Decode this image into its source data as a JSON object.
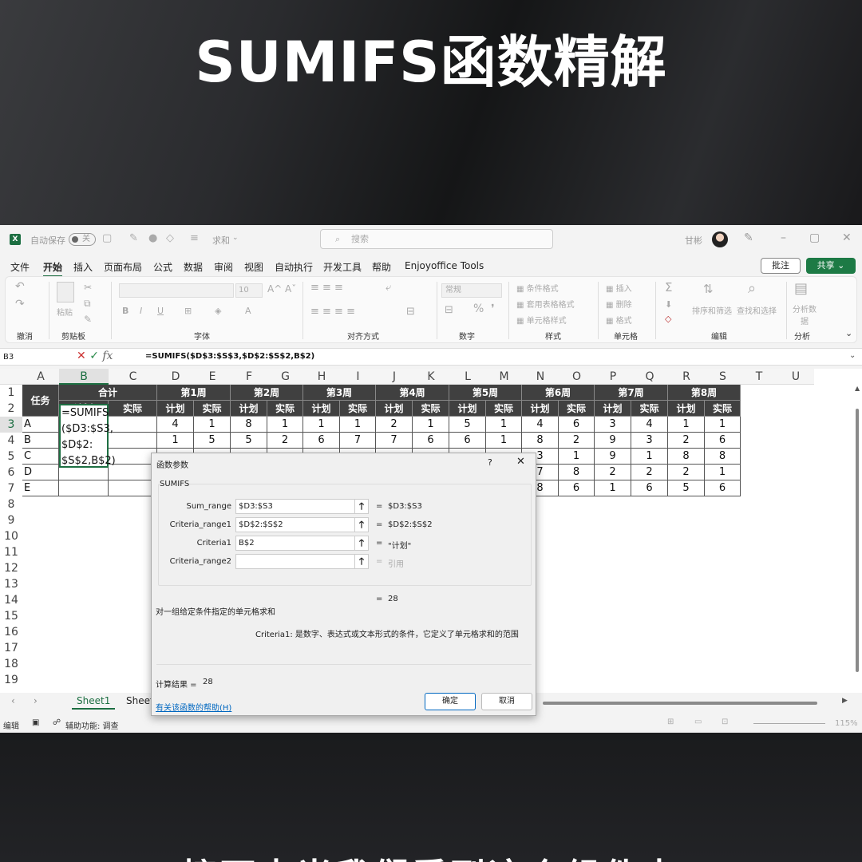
{
  "headline": "SUMIFS函数精解",
  "subtitle": "接下来当我们看到这个组件中",
  "titlebar": {
    "autosave_label": "自动保存",
    "autosave_state": "关",
    "doc_name": "求和",
    "search_placeholder": "搜索",
    "user": "甘彬"
  },
  "menu": {
    "items": [
      "文件",
      "开始",
      "插入",
      "页面布局",
      "公式",
      "数据",
      "审阅",
      "视图",
      "自动执行",
      "开发工具",
      "帮助",
      "Enjoyoffice Tools"
    ],
    "active": "开始",
    "comment_btn": "批注",
    "share_btn": "共享"
  },
  "ribbon": {
    "groups": [
      "撤消",
      "剪贴板",
      "字体",
      "对齐方式",
      "数字",
      "样式",
      "单元格",
      "编辑",
      "分析"
    ],
    "paste": "粘贴",
    "font_size": "10",
    "number_format": "常规",
    "style_items": [
      "条件格式",
      "套用表格格式",
      "单元格样式"
    ],
    "cell_items": [
      "插入",
      "删除",
      "格式"
    ],
    "edit_items": [
      "排序和筛选",
      "查找和选择"
    ],
    "analyze_item": "分析数据"
  },
  "formula_bar": {
    "name_box": "B3",
    "formula": "=SUMIFS($D$3:$S$3,$D$2:$S$2,B$2)"
  },
  "grid": {
    "columns": [
      "A",
      "B",
      "C",
      "D",
      "E",
      "F",
      "G",
      "H",
      "I",
      "J",
      "K",
      "L",
      "M",
      "N",
      "O",
      "P",
      "Q",
      "R",
      "S",
      "T",
      "U"
    ],
    "rows": [
      "1",
      "2",
      "3",
      "4",
      "5",
      "6",
      "7",
      "8",
      "9",
      "10",
      "11",
      "12",
      "13",
      "14",
      "15",
      "16",
      "17",
      "18",
      "19"
    ],
    "task_header": "任务",
    "total_header": "合计",
    "plan": "计划",
    "actual": "实际",
    "weeks": [
      "第1周",
      "第2周",
      "第3周",
      "第4周",
      "第5周",
      "第6周",
      "第7周",
      "第8周"
    ],
    "tasks": [
      "A",
      "B",
      "C",
      "D",
      "E"
    ],
    "values": [
      [
        4,
        1,
        8,
        1,
        1,
        1,
        2,
        1,
        5,
        1,
        4,
        6,
        3,
        4,
        1,
        1
      ],
      [
        1,
        5,
        5,
        2,
        6,
        7,
        7,
        6,
        6,
        1,
        8,
        2,
        9,
        3,
        2,
        6
      ],
      [
        null,
        null,
        null,
        null,
        null,
        null,
        null,
        null,
        null,
        null,
        3,
        1,
        9,
        1,
        8,
        8
      ],
      [
        null,
        null,
        null,
        null,
        null,
        null,
        null,
        null,
        null,
        null,
        7,
        8,
        2,
        2,
        2,
        1
      ],
      [
        null,
        null,
        null,
        null,
        null,
        null,
        null,
        null,
        null,
        null,
        8,
        6,
        1,
        6,
        5,
        6
      ]
    ],
    "editing_formula_lines": [
      "=SUMIFS",
      "($D3:$S3,",
      "$D$2:",
      "$S$2,B$2)"
    ]
  },
  "sheets": {
    "active": "Sheet1",
    "second": "Sheet"
  },
  "status": {
    "mode": "编辑",
    "accessibility": "辅助功能: 调查",
    "zoom": "115%"
  },
  "dialog": {
    "title": "函数参数",
    "help_q": "?",
    "close": "✕",
    "function": "SUMIFS",
    "args": [
      {
        "label": "Sum_range",
        "value": "$D3:$S3",
        "result": "$D3:$S3"
      },
      {
        "label": "Criteria_range1",
        "value": "$D$2:$S$2",
        "result": "$D$2:$S$2"
      },
      {
        "label": "Criteria1",
        "value": "B$2",
        "result": "\"计划\""
      },
      {
        "label": "Criteria_range2",
        "value": "",
        "result": "引用"
      }
    ],
    "formula_result_inline": "28",
    "description": "对一组给定条件指定的单元格求和",
    "arg_help": "Criteria1:  是数字、表达式或文本形式的条件，它定义了单元格求和的范围",
    "calc_result_label": "计算结果 =",
    "calc_result_value": "28",
    "help_link": "有关该函数的帮助(H)",
    "ok": "确定",
    "cancel": "取消"
  }
}
